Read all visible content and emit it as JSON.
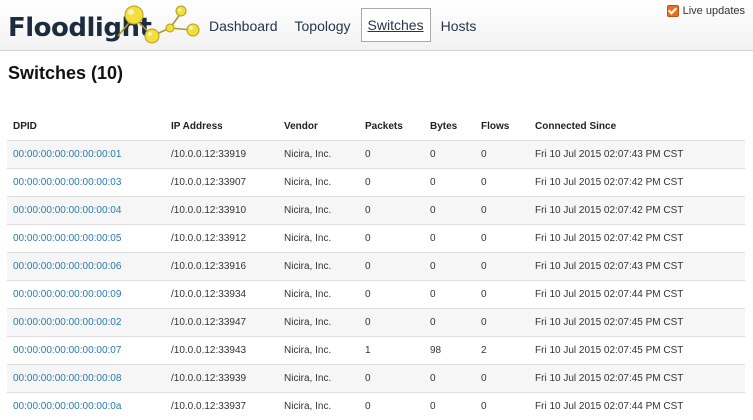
{
  "brand": {
    "name": "Floodlight"
  },
  "nav": {
    "items": [
      {
        "label": "Dashboard",
        "active": false
      },
      {
        "label": "Topology",
        "active": false
      },
      {
        "label": "Switches",
        "active": true
      },
      {
        "label": "Hosts",
        "active": false
      }
    ]
  },
  "live_updates": {
    "label": "Live updates",
    "checked": true
  },
  "page": {
    "title": "Switches (10)"
  },
  "table": {
    "columns": [
      "DPID",
      "IP Address",
      "Vendor",
      "Packets",
      "Bytes",
      "Flows",
      "Connected Since"
    ],
    "rows": [
      [
        "00:00:00:00:00:00:00:01",
        "/10.0.0.12:33919",
        "Nicira, Inc.",
        "0",
        "0",
        "0",
        "Fri 10 Jul 2015 02:07:43 PM CST"
      ],
      [
        "00:00:00:00:00:00:00:03",
        "/10.0.0.12:33907",
        "Nicira, Inc.",
        "0",
        "0",
        "0",
        "Fri 10 Jul 2015 02:07:42 PM CST"
      ],
      [
        "00:00:00:00:00:00:00:04",
        "/10.0.0.12:33910",
        "Nicira, Inc.",
        "0",
        "0",
        "0",
        "Fri 10 Jul 2015 02:07:42 PM CST"
      ],
      [
        "00:00:00:00:00:00:00:05",
        "/10.0.0.12:33912",
        "Nicira, Inc.",
        "0",
        "0",
        "0",
        "Fri 10 Jul 2015 02:07:42 PM CST"
      ],
      [
        "00:00:00:00:00:00:00:06",
        "/10.0.0.12:33916",
        "Nicira, Inc.",
        "0",
        "0",
        "0",
        "Fri 10 Jul 2015 02:07:43 PM CST"
      ],
      [
        "00:00:00:00:00:00:00:09",
        "/10.0.0.12:33934",
        "Nicira, Inc.",
        "0",
        "0",
        "0",
        "Fri 10 Jul 2015 02:07:44 PM CST"
      ],
      [
        "00:00:00:00:00:00:00:02",
        "/10.0.0.12:33947",
        "Nicira, Inc.",
        "0",
        "0",
        "0",
        "Fri 10 Jul 2015 02:07:45 PM CST"
      ],
      [
        "00:00:00:00:00:00:00:07",
        "/10.0.0.12:33943",
        "Nicira, Inc.",
        "1",
        "98",
        "2",
        "Fri 10 Jul 2015 02:07:45 PM CST"
      ],
      [
        "00:00:00:00:00:00:00:08",
        "/10.0.0.12:33939",
        "Nicira, Inc.",
        "0",
        "0",
        "0",
        "Fri 10 Jul 2015 02:07:45 PM CST"
      ],
      [
        "00:00:00:00:00:00:00:0a",
        "/10.0.0.12:33937",
        "Nicira, Inc.",
        "0",
        "0",
        "0",
        "Fri 10 Jul 2015 02:07:44 PM CST"
      ]
    ]
  },
  "colors": {
    "accent": "#2a7ab0",
    "brand_text": "#1c2b3e",
    "logo_yellow": "#f2df3c",
    "checkbox": "#e8711e"
  }
}
